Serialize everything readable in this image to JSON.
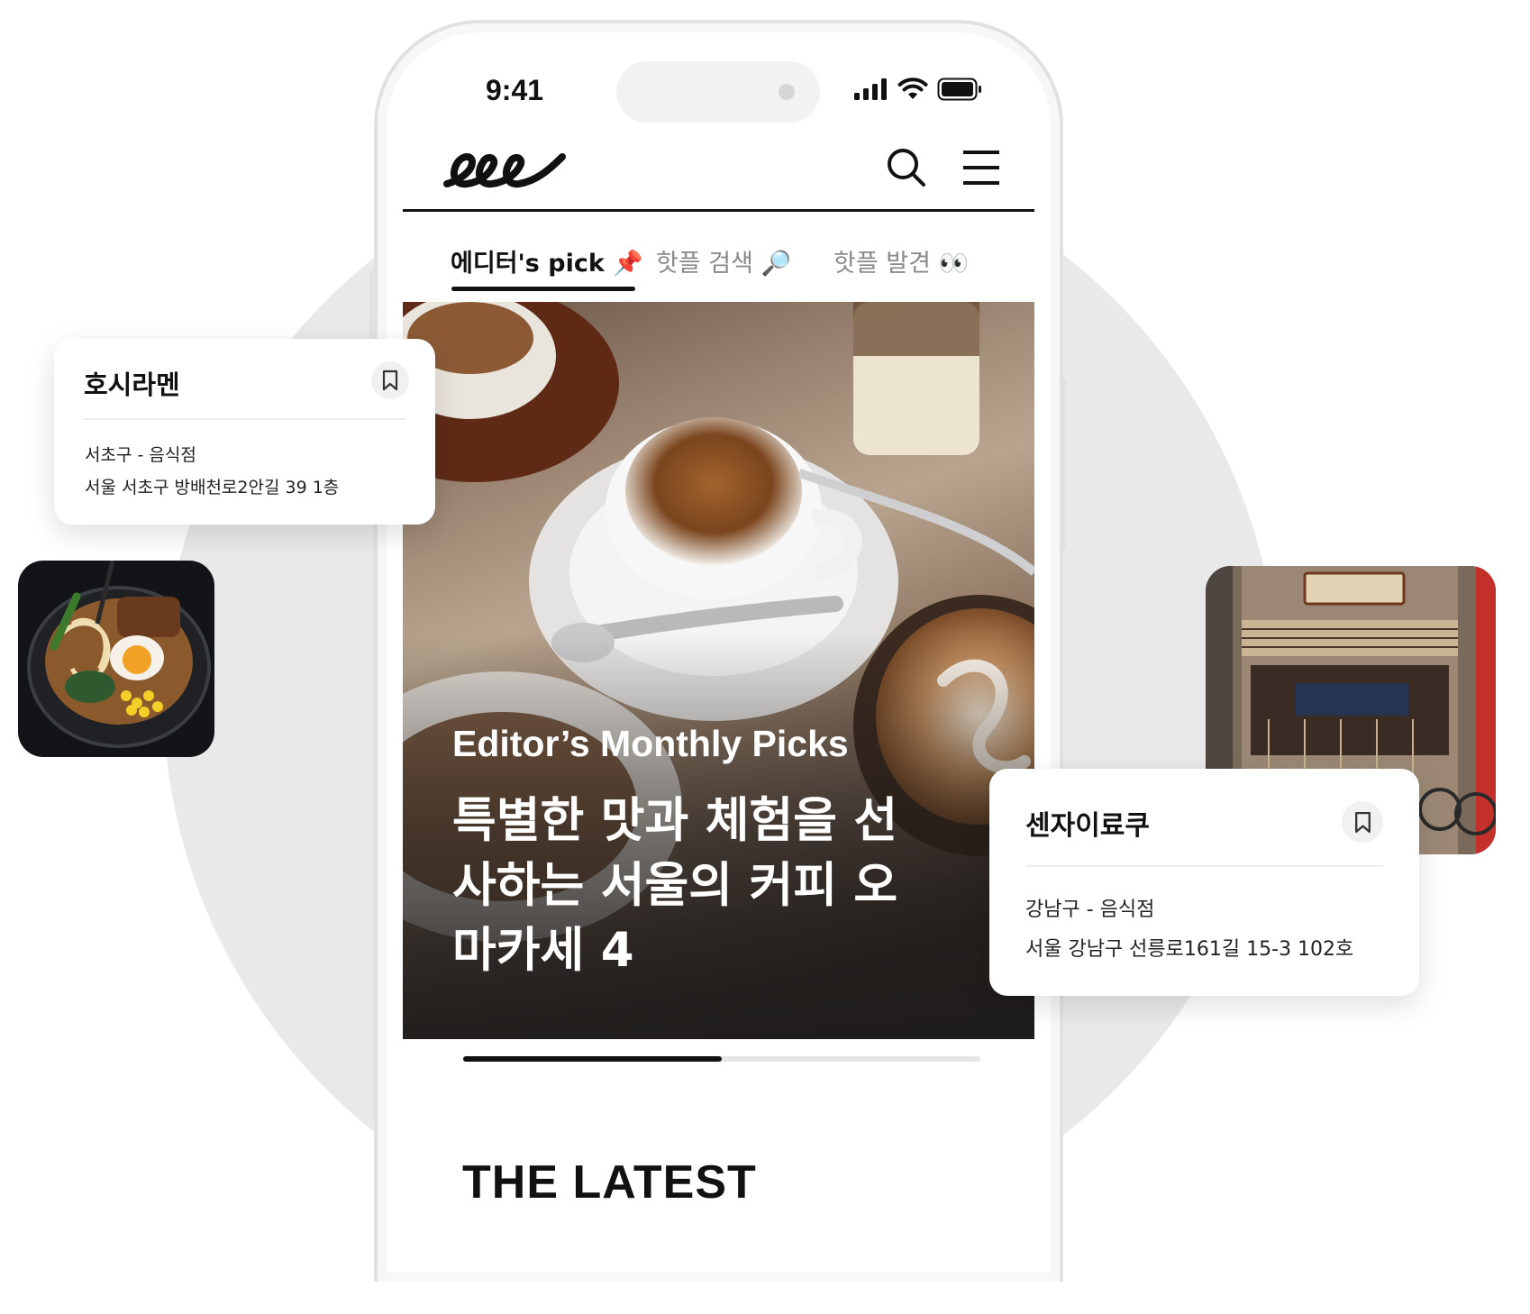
{
  "status_bar": {
    "time": "9:41"
  },
  "app": {
    "logo_text": "eee"
  },
  "tabs": [
    {
      "label": "에디터's pick",
      "emoji": "📌",
      "active": true
    },
    {
      "label": "핫플 검색",
      "emoji": "🔎",
      "active": false
    },
    {
      "label": "핫플 발견",
      "emoji": "👀",
      "active": false
    }
  ],
  "hero": {
    "kicker": "Editor’s Monthly Picks",
    "title": "특별한 맛과 체험을 선사하는 서울의 커피 오마카세 4"
  },
  "carousel_progress": 0.5,
  "section": {
    "title": "THE LATEST"
  },
  "cards": [
    {
      "name": "호시라멘",
      "category": "서초구 - 음식점",
      "address": "서울 서초구 방배천로2안길 39 1층"
    },
    {
      "name": "센자이료쿠",
      "category": "강남구 - 음식점",
      "address": "서울 강남구 선릉로161길 15-3 102호"
    }
  ],
  "colors": {
    "background_circle": "#e9e9ea",
    "text": "#111111",
    "inactive_tab": "#8a8a8e"
  }
}
